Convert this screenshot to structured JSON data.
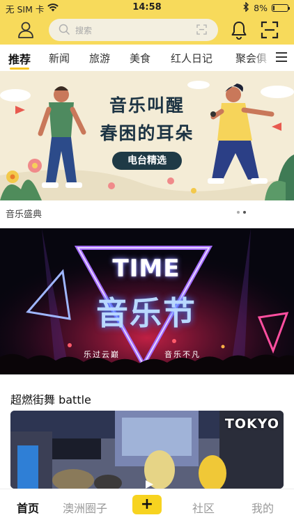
{
  "status_bar": {
    "carrier": "无 SIM 卡",
    "time": "14:58",
    "battery": "8%",
    "battery_level": 0.08,
    "icons": [
      "wifi-icon",
      "bluetooth-icon",
      "battery-icon"
    ]
  },
  "header": {
    "search_placeholder": "搜索",
    "icons": [
      "user-icon",
      "search-icon",
      "scan-icon",
      "bell-icon",
      "scan-icon"
    ]
  },
  "tabs": {
    "items": [
      {
        "label": "推荐",
        "active": true
      },
      {
        "label": "新闻",
        "active": false
      },
      {
        "label": "旅游",
        "active": false
      },
      {
        "label": "美食",
        "active": false
      },
      {
        "label": "红人日记",
        "active": false
      },
      {
        "label": "聚会俱",
        "active": false
      }
    ],
    "menu_icon": "menu-icon"
  },
  "banner": {
    "title_line1": "音乐叫醒",
    "title_line2": "春困的耳朵",
    "button_label": "电台精选"
  },
  "section1": {
    "label": "音乐盛典",
    "carousel_page": 2,
    "carousel_total": 2
  },
  "concert": {
    "headline": "TIME",
    "headline_zh": "音乐节",
    "sub_left": "乐过云巅",
    "sub_right": "音乐不凡"
  },
  "section2": {
    "title": "超燃街舞 battle",
    "video_overlay": "TOKYO"
  },
  "bottom_nav": {
    "items": [
      {
        "label": "首页",
        "active": true
      },
      {
        "label": "澳洲圈子",
        "active": false
      },
      {
        "label": "+",
        "active": false
      },
      {
        "label": "社区",
        "active": false
      },
      {
        "label": "我的",
        "active": false
      }
    ]
  },
  "colors": {
    "accent_yellow": "#f7da5b",
    "banner_bg": "#f4ecd6",
    "dark_teal": "#1f3a46"
  }
}
